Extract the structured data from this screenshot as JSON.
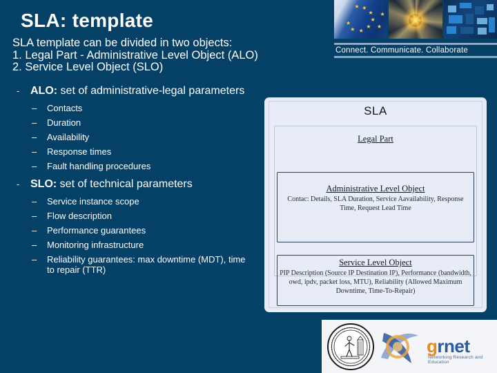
{
  "slide": {
    "title": "SLA: template",
    "intro_lines": [
      "SLA template can be divided in two objects:",
      "1. Legal Part - Administrative Level Object (ALO)",
      "2. Service Level Object (SLO)"
    ]
  },
  "header": {
    "tagline": "Connect. Communicate. Collaborate",
    "tiles": [
      {
        "name": "eu-flag-image"
      },
      {
        "name": "glowing-star-image"
      },
      {
        "name": "network-circuit-image"
      }
    ]
  },
  "bullets": {
    "marker_level1": "-",
    "marker_level2": "–",
    "groups": [
      {
        "heading_bold": "ALO:",
        "heading_rest": " set of administrative-legal parameters",
        "items": [
          "Contacts",
          "Duration",
          "Availability",
          "Response times",
          "Fault handling procedures"
        ]
      },
      {
        "heading_bold": "SLO:",
        "heading_rest": " set of technical parameters",
        "items": [
          "Service instance scope",
          "Flow description",
          "Performance guarantees",
          "Monitoring infrastructure",
          "Reliability guarantees: max downtime (MDT), time to repair (TTR)"
        ]
      }
    ]
  },
  "diagram": {
    "sla_label": "SLA",
    "legal_part_label": "Legal Part",
    "alo": {
      "title": "Administrative Level Object",
      "body": "Contac: Details, SLA Duration, Service Aavailability, Response Time, Request Lead Time"
    },
    "slo": {
      "title": "Service Level Object",
      "body": "PIP Description (Source IP  Destination IP), Performance (bandwidth, owd, ipdv, packet loss, MTU), Reliability (Allowed Maximum Downtime, Time-To-Repair)"
    }
  },
  "footer": {
    "grnet_g": "g",
    "grnet_rnet": "rnet",
    "grnet_subtitle": "Networking Research and Education",
    "ntua_seal_name": "ntua-seal"
  },
  "colors": {
    "background": "#054066",
    "panel": "#e7ecf7",
    "tagline_rule": "#8fa8c8",
    "grnet_orange": "#e98a1c",
    "grnet_blue": "#2a5b9e"
  }
}
